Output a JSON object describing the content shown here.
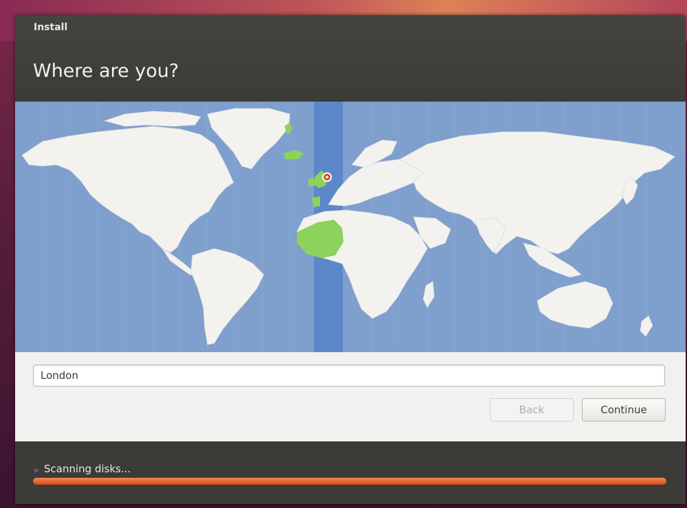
{
  "window": {
    "title": "Install"
  },
  "page": {
    "title": "Where are you?"
  },
  "location": {
    "city_value": "London",
    "selected_timezone_marker": "London"
  },
  "buttons": {
    "back_label": "Back",
    "continue_label": "Continue",
    "back_enabled": false
  },
  "status": {
    "text": "Scanning disks...",
    "progress": 1.0
  },
  "colors": {
    "ocean": "#7f9fcd",
    "land": "#f4f2ef",
    "timezone_band": "#5c87c9",
    "timezone_land": "#8bd35c",
    "accent": "#dd4814",
    "chrome": "#3c3b37"
  },
  "icons": {
    "map_marker": "location-pin-icon",
    "status_expander": "expander-arrow-icon"
  }
}
